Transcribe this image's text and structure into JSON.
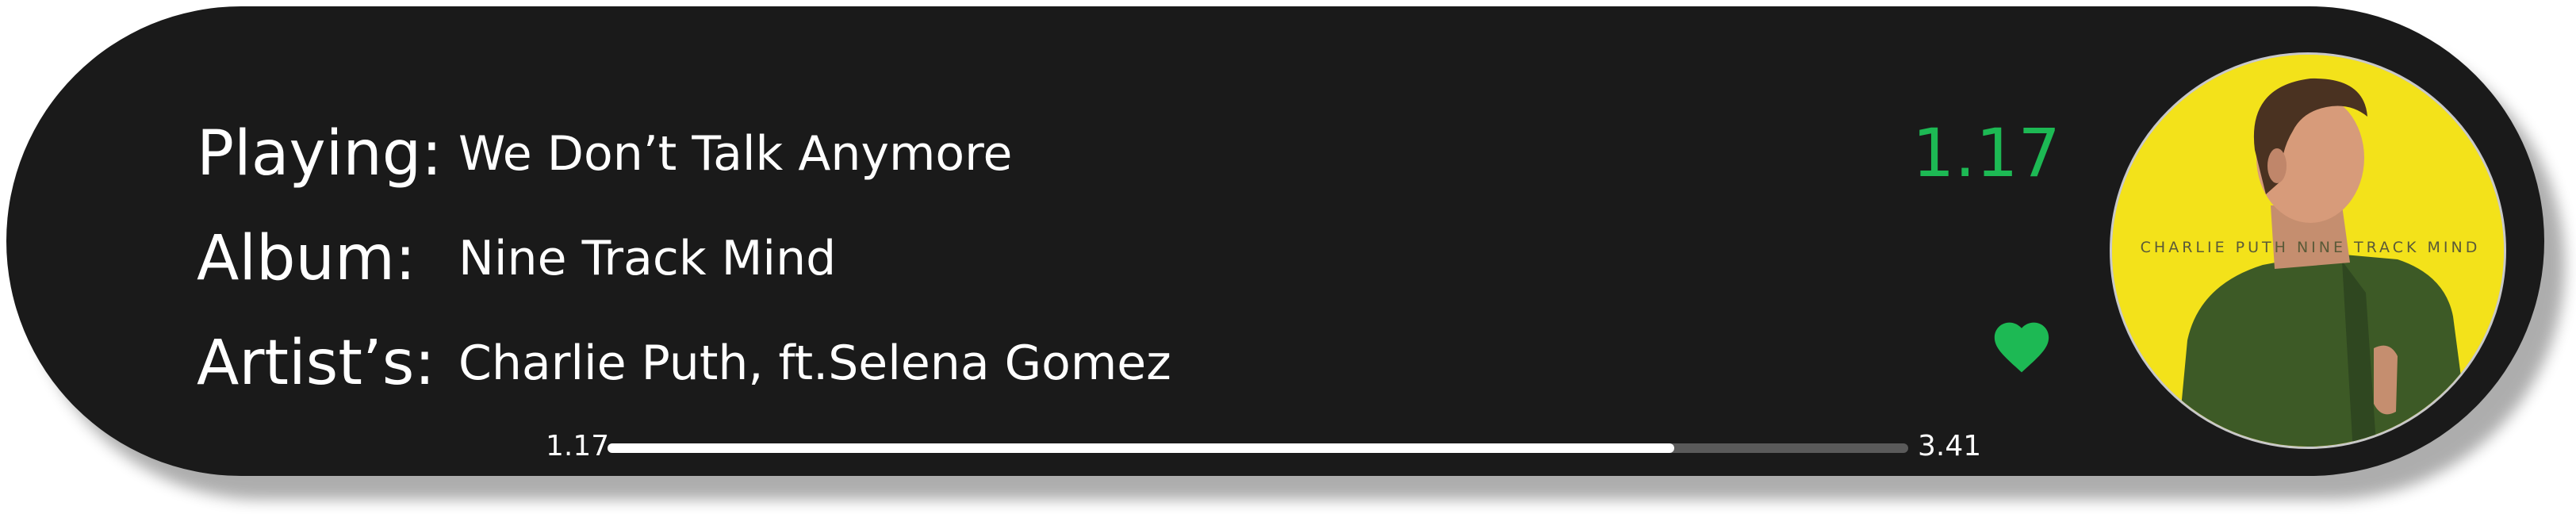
{
  "player": {
    "labels": {
      "playing": "Playing:",
      "album": "Album:",
      "artist": "Artist’s:"
    },
    "track": {
      "title": "We Don’t Talk Anymore",
      "album": "Nine Track Mind",
      "artist": "Charlie Puth, ft.Selena Gomez"
    },
    "current_time_display": "1.17",
    "progress": {
      "elapsed": "1.17",
      "duration": "3.41",
      "fraction": 0.82
    },
    "favorite_icon": "heart-icon",
    "cover_text": "CHARLIE PUTH NINE TRACK MIND",
    "colors": {
      "background": "#1a1a1a",
      "accent": "#1db954",
      "cover_bg": "#f3e21a",
      "jacket": "#3d5a26",
      "progress_track": "#5a5a5a",
      "progress_fill": "#ffffff"
    }
  }
}
